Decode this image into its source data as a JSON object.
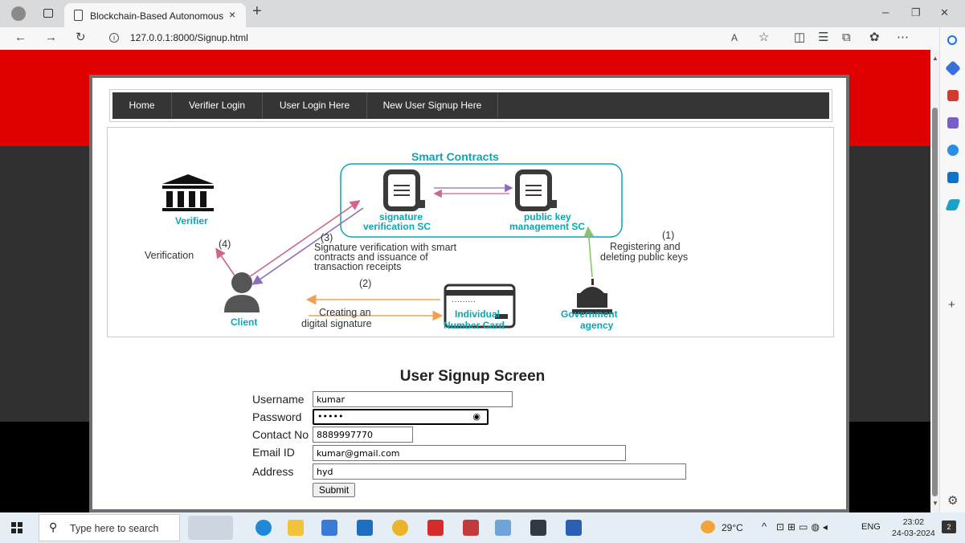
{
  "browser": {
    "tab_title": "Blockchain-Based Autonomous I",
    "tab_close": "×",
    "new_tab": "+",
    "url": "127.0.0.1:8000/Signup.html",
    "window_minimize": "–",
    "window_restore": "❐",
    "window_close": "✕"
  },
  "nav": {
    "items": [
      "Home",
      "Verifier Login",
      "User Login Here",
      "New User Signup Here"
    ]
  },
  "diagram": {
    "title": "Smart Contracts",
    "sig_sc": [
      "signature",
      "verification SC"
    ],
    "pk_sc": [
      "public key",
      "management SC"
    ],
    "verifier": "Verifier",
    "client": "Client",
    "card": [
      "Individual",
      "Number Card"
    ],
    "government": [
      "Government",
      "agency"
    ],
    "step1": [
      "(1)",
      "Registering and",
      "deleting public keys"
    ],
    "step2": [
      "(2)",
      "Creating an",
      "digital signature"
    ],
    "step3": [
      "(3)",
      "Signature verification with smart",
      "contracts and issuance of",
      "transaction receipts"
    ],
    "step4": [
      "(4)",
      "Verification"
    ],
    "card_dots": "·········"
  },
  "form": {
    "title": "User Signup Screen",
    "username_label": "Username",
    "username_value": "kumar",
    "password_label": "Password",
    "password_value": "•••••",
    "contact_label": "Contact No",
    "contact_value": "8889997770",
    "email_label": "Email ID",
    "email_value": "kumar@gmail.com",
    "address_label": "Address",
    "address_value": "hyd",
    "submit_label": "Submit"
  },
  "taskbar": {
    "search_placeholder": "Type here to search",
    "temperature": "29°C",
    "language": "ENG",
    "time": "23:02",
    "date": "24-03-2024",
    "notifications": "2"
  },
  "colors": {
    "header_red": "#e00000",
    "band_gray": "#303030",
    "nav_bg": "#353535",
    "diagram_teal": "#0aa6b3"
  }
}
